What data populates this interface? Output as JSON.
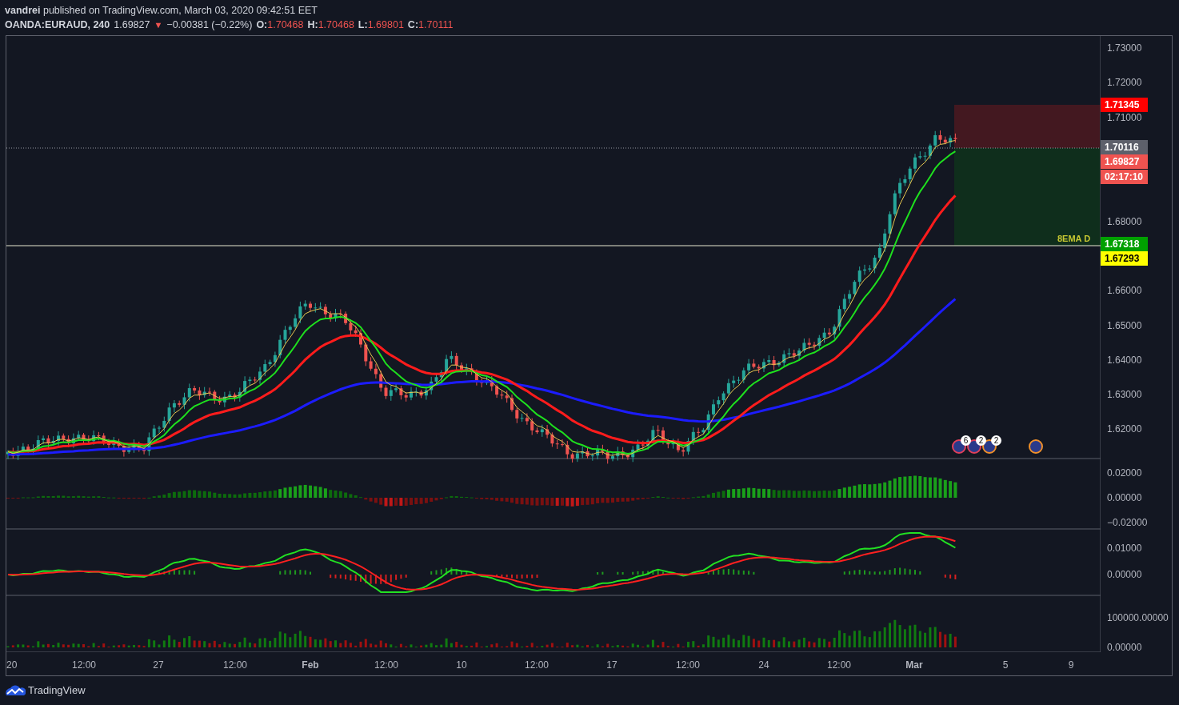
{
  "header": {
    "byline": "**vandrei** published on TradingView.com, March 03, 2020 09:42:51 EET",
    "symbol": "OANDA:EURAUD, 240",
    "last": "1.69827",
    "direction": "▼",
    "change": "−0.00381 (−0.22%)",
    "ohlc": [
      {
        "label": "O:",
        "value": "1.70468"
      },
      {
        "label": "H:",
        "value": "1.70468"
      },
      {
        "label": "L:",
        "value": "1.69801"
      },
      {
        "label": "C:",
        "value": "1.70111"
      }
    ]
  },
  "price_axis": [
    "1.73000",
    "1.72000",
    "1.71000",
    "1.68000",
    "1.66000",
    "1.65000",
    "1.64000",
    "1.63000",
    "1.62000"
  ],
  "price_badges": [
    {
      "text": "1.71345",
      "color": "#ff0000"
    },
    {
      "text": "1.70116",
      "color": "#5d606b"
    },
    {
      "text": "1.69827",
      "color": "#ef5350"
    },
    {
      "text": "02:17:10",
      "color": "#ef5350"
    },
    {
      "text": "1.67318",
      "color": "#00a000"
    },
    {
      "text": "1.67293",
      "color": "#ffff00"
    }
  ],
  "level_label": "8EMA D",
  "events": [
    {
      "count": "6",
      "color": "#e0405a"
    },
    {
      "count": "2",
      "color": "#e0405a"
    },
    {
      "count": "2",
      "color": "#f0902a"
    },
    {
      "color": "#f0902a"
    }
  ],
  "panes": [
    {
      "ticks": [
        "0.02000",
        "0.00000",
        "−0.02000"
      ]
    },
    {
      "ticks": [
        "0.01000",
        "0.00000"
      ]
    },
    {
      "ticks": [
        "100000.00000",
        "0.00000"
      ]
    }
  ],
  "time_axis": [
    {
      "text": "20",
      "kind": "day"
    },
    {
      "text": "12:00",
      "kind": "hour"
    },
    {
      "text": "27",
      "kind": "day"
    },
    {
      "text": "12:00",
      "kind": "hour"
    },
    {
      "text": "Feb",
      "kind": "month"
    },
    {
      "text": "12:00",
      "kind": "hour"
    },
    {
      "text": "10",
      "kind": "day"
    },
    {
      "text": "12:00",
      "kind": "hour"
    },
    {
      "text": "17",
      "kind": "day"
    },
    {
      "text": "12:00",
      "kind": "hour"
    },
    {
      "text": "24",
      "kind": "day"
    },
    {
      "text": "12:00",
      "kind": "hour"
    },
    {
      "text": "Mar",
      "kind": "month"
    },
    {
      "text": "5",
      "kind": "day"
    },
    {
      "text": "9",
      "kind": "day"
    }
  ],
  "footer": {
    "logo": "TradingView"
  }
}
